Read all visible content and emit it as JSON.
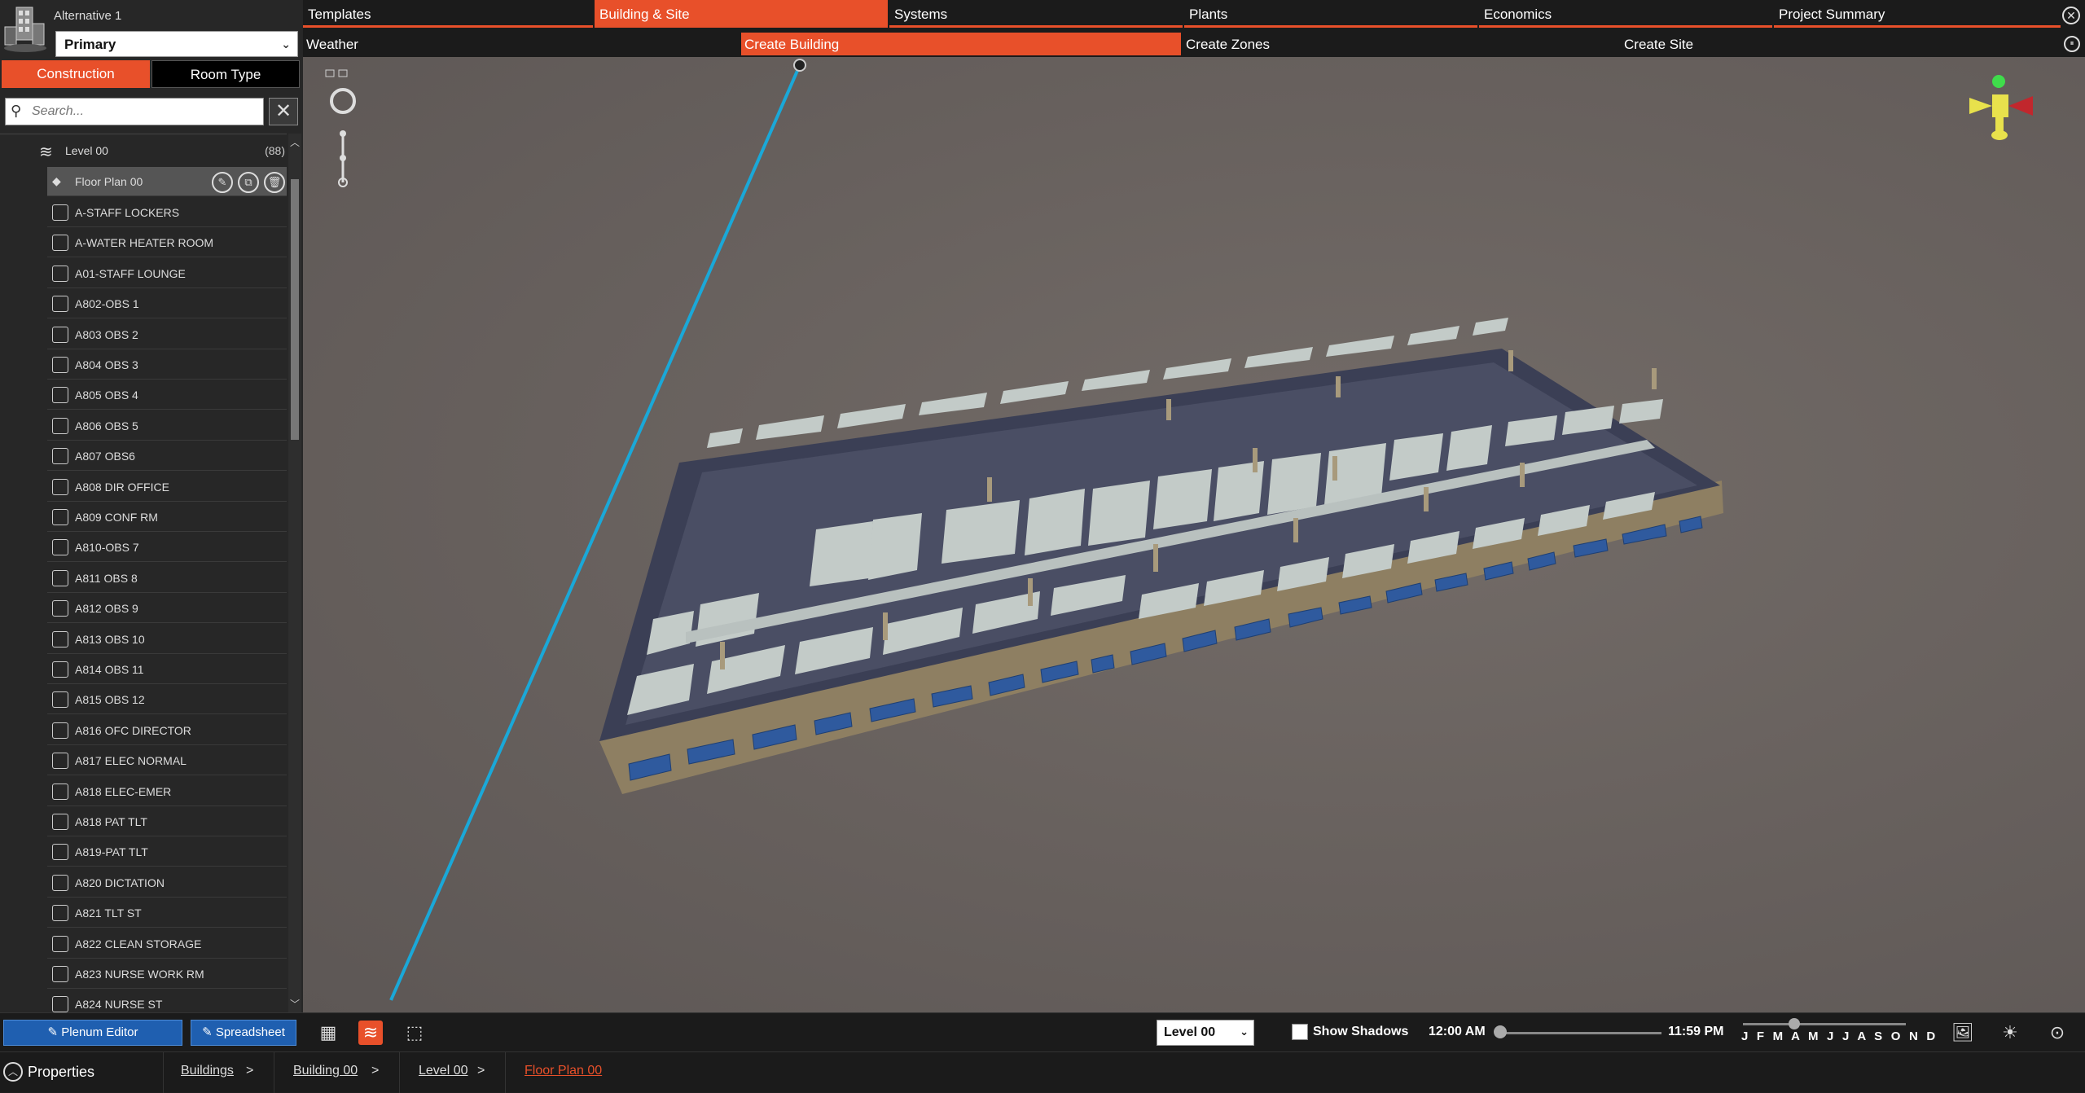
{
  "app": {
    "alternative_label": "Alternative 1",
    "alternative_value": "Primary"
  },
  "mode_tabs": {
    "construction": "Construction",
    "room_type": "Room Type"
  },
  "search": {
    "placeholder": "Search..."
  },
  "tree": {
    "level": {
      "label": "Level 00",
      "count": "(88)"
    },
    "floor_plan": "Floor Plan 00",
    "items": [
      "A-STAFF LOCKERS",
      "A-WATER HEATER ROOM",
      "A01-STAFF LOUNGE",
      "A802-OBS 1",
      "A803 OBS 2",
      "A804 OBS 3",
      "A805 OBS 4",
      "A806 OBS 5",
      "A807 OBS6",
      "A808 DIR OFFICE",
      "A809 CONF RM",
      "A810-OBS 7",
      "A811 OBS 8",
      "A812 OBS 9",
      "A813 OBS 10",
      "A814 OBS 11",
      "A815 OBS 12",
      "A816 OFC DIRECTOR",
      "A817 ELEC NORMAL",
      "A818 ELEC-EMER",
      "A818 PAT TLT",
      "A819-PAT TLT",
      "A820 DICTATION",
      "A821 TLT ST",
      "A822 CLEAN STORAGE",
      "A823 NURSE WORK RM",
      "A824 NURSE ST"
    ]
  },
  "top_tabs": [
    "Templates",
    "Building & Site",
    "Systems",
    "Plants",
    "Economics",
    "Project Summary"
  ],
  "sub_tabs": [
    "Weather",
    "Create Building",
    "Create Zones",
    "Create Site"
  ],
  "toolbar": {
    "plenum_editor": "Plenum Editor",
    "spreadsheet": "Spreadsheet",
    "level_select": "Level 00",
    "show_shadows": "Show Shadows",
    "time_start": "12:00 AM",
    "time_end": "11:59 PM",
    "months": "J F M A M J J A S O N D"
  },
  "status": {
    "properties": "Properties",
    "breadcrumbs": [
      "Buildings",
      "Building 00",
      "Level 00",
      "Floor Plan 00"
    ]
  },
  "colors": {
    "accent": "#e8502a",
    "button_blue": "#1f5fb0",
    "guide_line": "#1aa8d8"
  }
}
